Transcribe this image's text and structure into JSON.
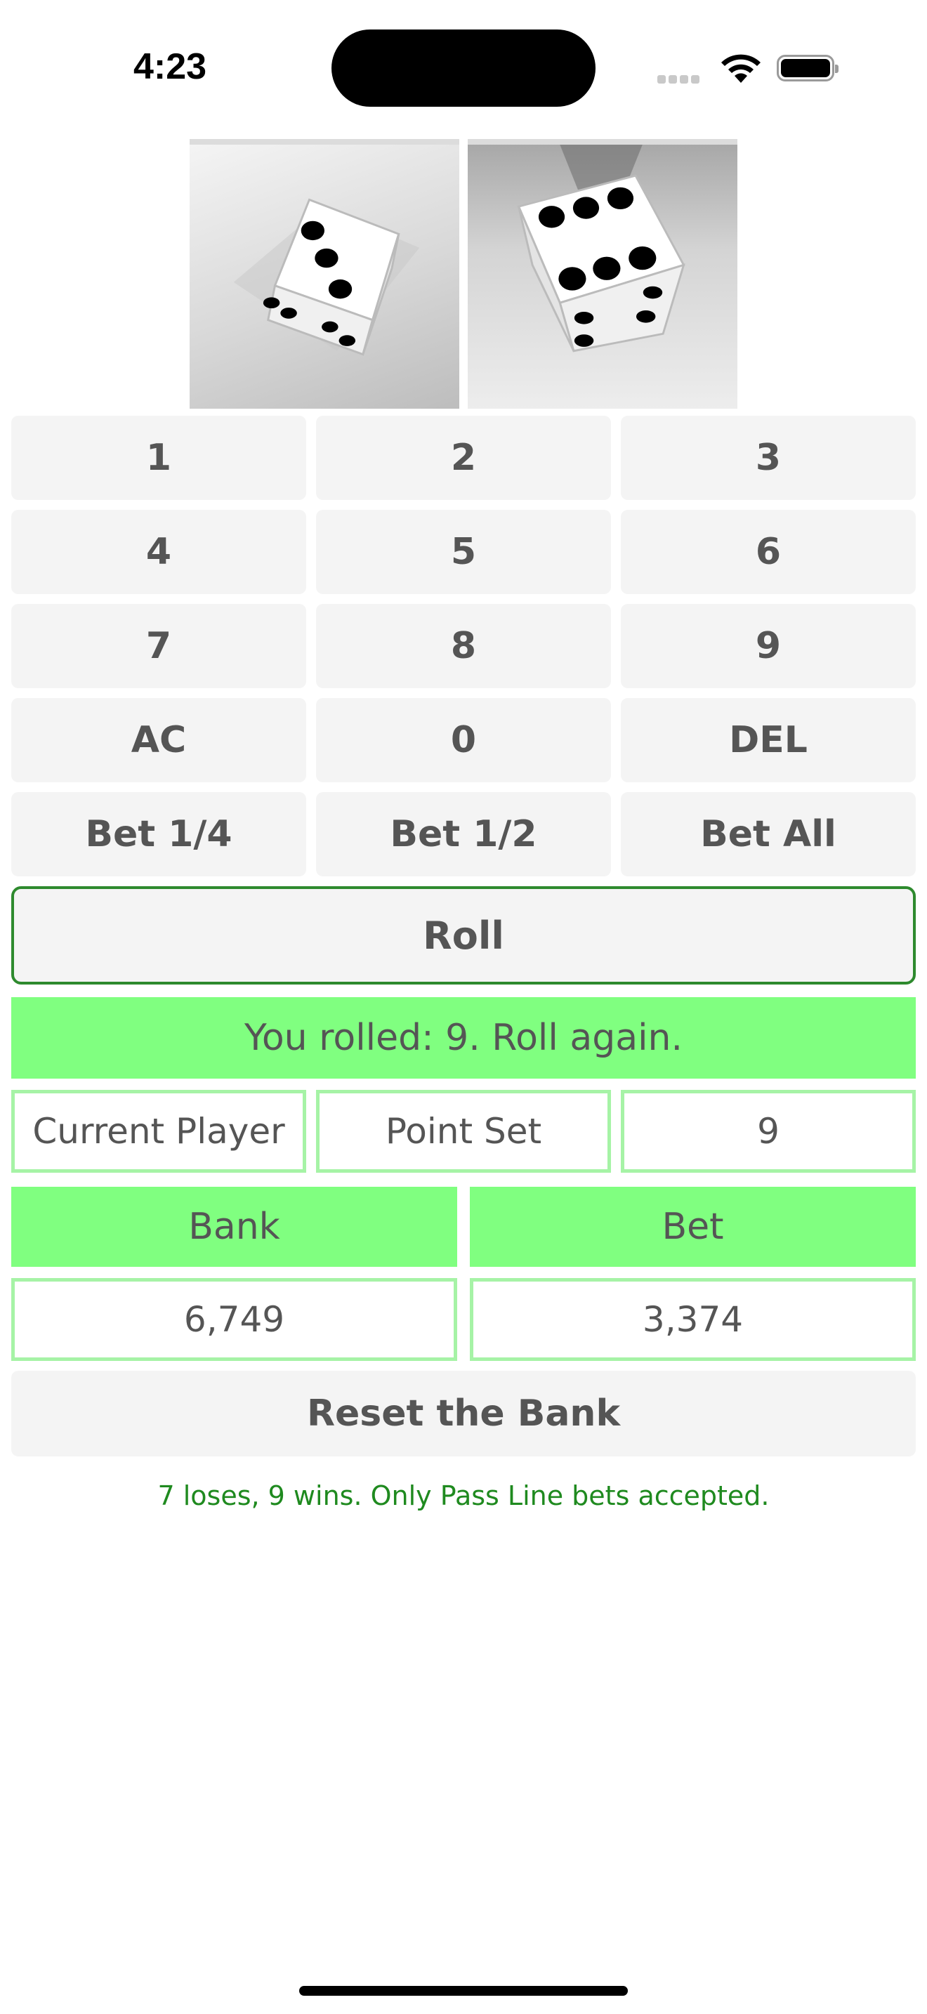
{
  "status_bar": {
    "time": "4:23"
  },
  "dice": [
    {
      "name": "die-left",
      "face": 3
    },
    {
      "name": "die-right",
      "face": 6
    }
  ],
  "keypad": {
    "keys": [
      "1",
      "2",
      "3",
      "4",
      "5",
      "6",
      "7",
      "8",
      "9",
      "AC",
      "0",
      "DEL",
      "Bet 1/4",
      "Bet 1/2",
      "Bet All"
    ]
  },
  "roll": {
    "label": "Roll"
  },
  "result": {
    "message": "You rolled: 9. Roll again."
  },
  "info": {
    "player_label": "Current Player",
    "point_label": "Point Set",
    "point_value": "9"
  },
  "bank": {
    "label": "Bank",
    "value": "6,749"
  },
  "bet": {
    "label": "Bet",
    "value": "3,374"
  },
  "reset": {
    "label": "Reset the Bank"
  },
  "rules": {
    "note": "7 loses, 9 wins. Only Pass Line bets accepted."
  },
  "colors": {
    "accent_green": "#80ff80",
    "border_green": "#a6f3a6",
    "roll_border": "#2e8a2e",
    "note_green": "#1f8a1f"
  }
}
